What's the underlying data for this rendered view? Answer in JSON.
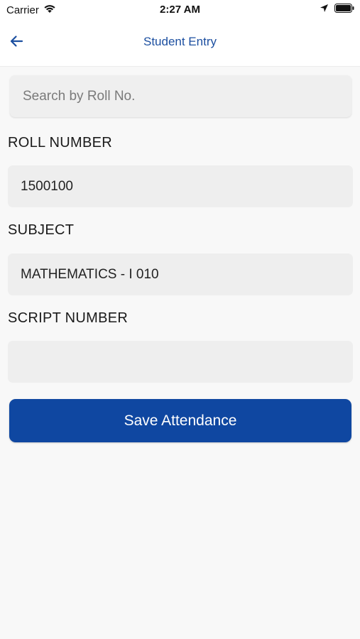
{
  "status_bar": {
    "carrier": "Carrier",
    "time": "2:27 AM"
  },
  "nav": {
    "title": "Student Entry",
    "back_icon": "arrow-left-icon"
  },
  "search": {
    "placeholder": "Search by Roll No."
  },
  "form": {
    "roll_number_label": "ROLL NUMBER",
    "roll_number_value": "1500100",
    "subject_label": "SUBJECT",
    "subject_value": "MATHEMATICS - I 010",
    "script_number_label": "SCRIPT NUMBER",
    "script_number_value": ""
  },
  "actions": {
    "save_label": "Save Attendance"
  },
  "colors": {
    "accent": "#0f47a1",
    "nav_title": "#1c4fa0",
    "background": "#f8f8f8",
    "field_bg": "#eeeeee"
  }
}
